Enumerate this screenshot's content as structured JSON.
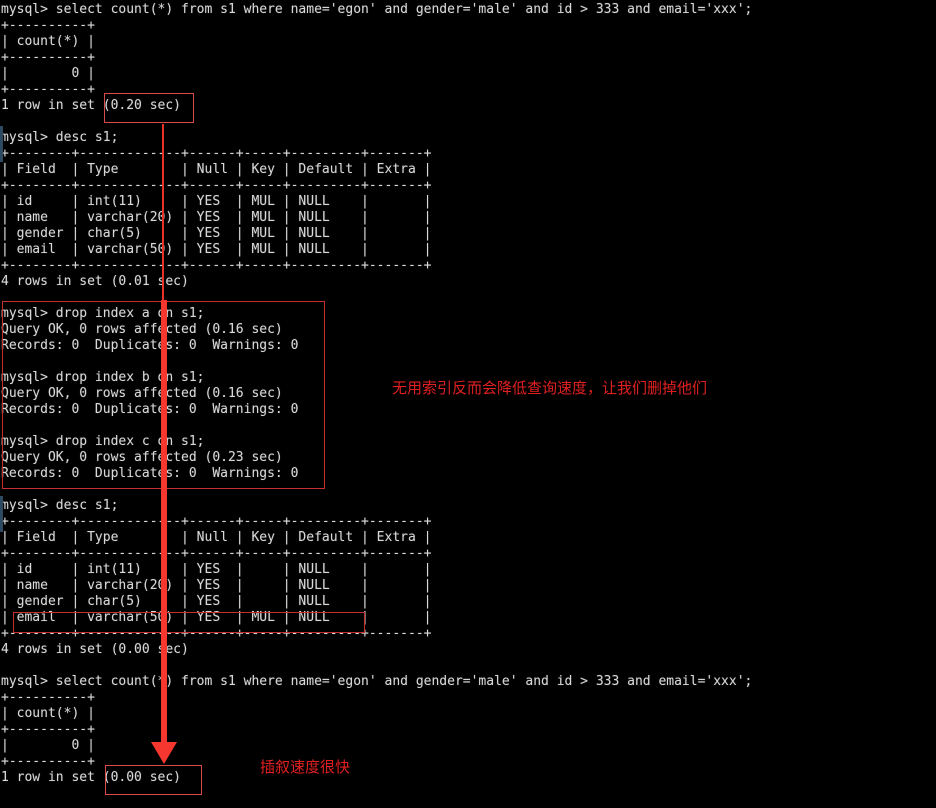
{
  "terminal": {
    "prompt": "mysql>",
    "lines": [
      "mysql> select count(*) from s1 where name='egon' and gender='male' and id > 333 and email='xxx';",
      "+----------+",
      "| count(*) |",
      "+----------+",
      "|        0 |",
      "+----------+",
      "1 row in set (0.20 sec)",
      "",
      "mysql> desc s1;",
      "+--------+-------------+------+-----+---------+-------+",
      "| Field  | Type        | Null | Key | Default | Extra |",
      "+--------+-------------+------+-----+---------+-------+",
      "| id     | int(11)     | YES  | MUL | NULL    |       |",
      "| name   | varchar(20) | YES  | MUL | NULL    |       |",
      "| gender | char(5)     | YES  | MUL | NULL    |       |",
      "| email  | varchar(50) | YES  | MUL | NULL    |       |",
      "+--------+-------------+------+-----+---------+-------+",
      "4 rows in set (0.01 sec)",
      "",
      "mysql> drop index a on s1;",
      "Query OK, 0 rows affected (0.16 sec)",
      "Records: 0  Duplicates: 0  Warnings: 0",
      "",
      "mysql> drop index b on s1;",
      "Query OK, 0 rows affected (0.16 sec)",
      "Records: 0  Duplicates: 0  Warnings: 0",
      "",
      "mysql> drop index c on s1;",
      "Query OK, 0 rows affected (0.23 sec)",
      "Records: 0  Duplicates: 0  Warnings: 0",
      "",
      "mysql> desc s1;",
      "+--------+-------------+------+-----+---------+-------+",
      "| Field  | Type        | Null | Key | Default | Extra |",
      "+--------+-------------+------+-----+---------+-------+",
      "| id     | int(11)     | YES  |     | NULL    |       |",
      "| name   | varchar(20) | YES  |     | NULL    |       |",
      "| gender | char(5)     | YES  |     | NULL    |       |",
      "| email  | varchar(50) | YES  | MUL | NULL    |       |",
      "+--------+-------------+------+-----+---------+-------+",
      "4 rows in set (0.00 sec)",
      "",
      "mysql> select count(*) from s1 where name='egon' and gender='male' and id > 333 and email='xxx';",
      "+----------+",
      "| count(*) |",
      "+----------+",
      "|        0 |",
      "+----------+",
      "1 row in set (0.00 sec)"
    ],
    "queries": {
      "select_count": "select count(*) from s1 where name='egon' and gender='male' and id > 333 and email='xxx';",
      "desc_table": "desc s1;",
      "drop_index_a": "drop index a on s1;",
      "drop_index_b": "drop index b on s1;",
      "drop_index_c": "drop index c on s1;"
    },
    "results": {
      "count_column": "count(*)",
      "count_value": "0",
      "timing_before": "1 row in set (0.20 sec)",
      "timing_after": "1 row in set (0.00 sec)",
      "desc_timing_before": "4 rows in set (0.01 sec)",
      "desc_timing_after": "4 rows in set (0.00 sec)",
      "query_ok_a": "Query OK, 0 rows affected (0.16 sec)",
      "query_ok_b": "Query OK, 0 rows affected (0.16 sec)",
      "query_ok_c": "Query OK, 0 rows affected (0.23 sec)",
      "records_line": "Records: 0  Duplicates: 0  Warnings: 0"
    },
    "desc_table_before": {
      "headers": [
        "Field",
        "Type",
        "Null",
        "Key",
        "Default",
        "Extra"
      ],
      "rows": [
        [
          "id",
          "int(11)",
          "YES",
          "MUL",
          "NULL",
          ""
        ],
        [
          "name",
          "varchar(20)",
          "YES",
          "MUL",
          "NULL",
          ""
        ],
        [
          "gender",
          "char(5)",
          "YES",
          "MUL",
          "NULL",
          ""
        ],
        [
          "email",
          "varchar(50)",
          "YES",
          "MUL",
          "NULL",
          ""
        ]
      ]
    },
    "desc_table_after": {
      "headers": [
        "Field",
        "Type",
        "Null",
        "Key",
        "Default",
        "Extra"
      ],
      "rows": [
        [
          "id",
          "int(11)",
          "YES",
          "",
          "NULL",
          ""
        ],
        [
          "name",
          "varchar(20)",
          "YES",
          "",
          "NULL",
          ""
        ],
        [
          "gender",
          "char(5)",
          "YES",
          "",
          "NULL",
          ""
        ],
        [
          "email",
          "varchar(50)",
          "YES",
          "MUL",
          "NULL",
          ""
        ]
      ]
    }
  },
  "annotations": {
    "note_drop_indexes": "无用索引反而会降低查询速度，让我们删掉他们",
    "note_fast": "插叙速度很快",
    "accent_color": "#e02020",
    "box_color": "#c23030",
    "arrow_color": "#f5372f",
    "highlight_before_timing": "(0.20 sec)",
    "highlight_after_timing": "(0.00 sec)",
    "highlight_email_row": "| email  | varchar(50) | YES  | MUL | NULL    |"
  }
}
